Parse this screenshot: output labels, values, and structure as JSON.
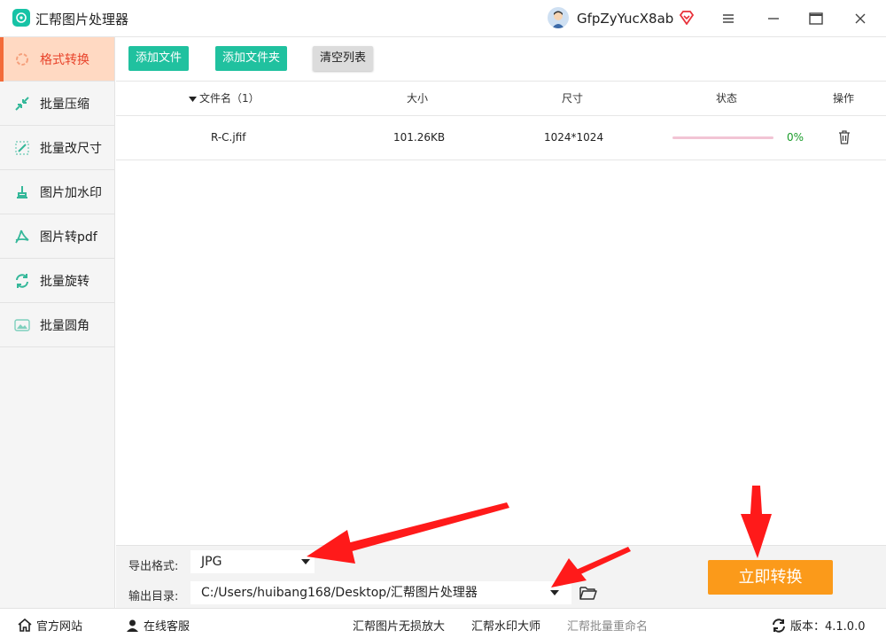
{
  "app": {
    "title": "汇帮图片处理器",
    "username": "GfpZyYucX8ab"
  },
  "sidebar": {
    "items": [
      {
        "label": "格式转换",
        "icon": "format-convert-icon",
        "active": true
      },
      {
        "label": "批量压缩",
        "icon": "compress-icon"
      },
      {
        "label": "批量改尺寸",
        "icon": "resize-icon"
      },
      {
        "label": "图片加水印",
        "icon": "watermark-icon"
      },
      {
        "label": "图片转pdf",
        "icon": "pdf-icon"
      },
      {
        "label": "批量旋转",
        "icon": "rotate-icon"
      },
      {
        "label": "批量圆角",
        "icon": "rounded-corner-icon"
      }
    ]
  },
  "toolbar": {
    "add_file": "添加文件",
    "add_folder": "添加文件夹",
    "clear_list": "清空列表"
  },
  "table": {
    "headers": {
      "name": "文件名（1）",
      "size": "大小",
      "dimension": "尺寸",
      "status": "状态",
      "action": "操作"
    },
    "rows": [
      {
        "name": "R-C.jfif",
        "size": "101.26KB",
        "dimension": "1024*1024",
        "progress_text": "0%",
        "progress": 0
      }
    ]
  },
  "settings": {
    "format_label": "导出格式:",
    "format_value": "JPG",
    "output_label": "输出目录:",
    "output_value": "C:/Users/huibang168/Desktop/汇帮图片处理器",
    "convert_button": "立即转换"
  },
  "footer": {
    "website": "官方网站",
    "service": "在线客服",
    "link1": "汇帮图片无损放大",
    "link2": "汇帮水印大师",
    "link3": "汇帮批量重命名",
    "version": "版本：4.1.0.0"
  },
  "colors": {
    "accent": "#20c19f",
    "active_bg": "#ffd9c2",
    "active_text": "#e8432a",
    "convert": "#fb9a1a",
    "annotation": "#ff1a1a"
  }
}
